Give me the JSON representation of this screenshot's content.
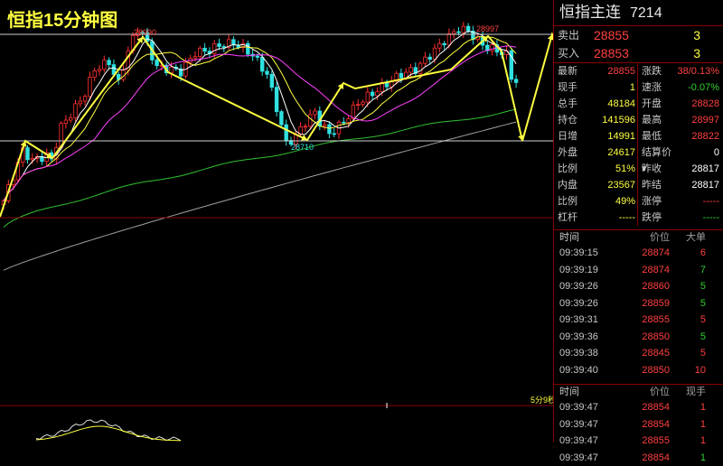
{
  "chart": {
    "title": "恒指15分钟图",
    "peak1_label": "28990",
    "peak2_label": "28997",
    "trough_label": "28710",
    "timer_label": "5分9秒",
    "colors": {
      "up": "#ff3030",
      "down": "#30e0e0",
      "ma1": "#ffffff",
      "ma2": "#ffff40",
      "ma3": "#ff40ff",
      "ma4": "#30c030",
      "ma5": "#a0a0a0",
      "arrow": "#ffff40"
    }
  },
  "chart_data": {
    "type": "candlestick",
    "ylim": [
      28590,
      29045
    ],
    "hlines": [
      28994,
      28725
    ],
    "annotations": [
      {
        "text": "28990",
        "x": 28,
        "y": 28990
      },
      {
        "text": "28997",
        "x": 95,
        "y": 28997
      },
      {
        "text": "28710",
        "x": 59,
        "y": 28710
      }
    ]
  },
  "panel": {
    "name": "恒指主连",
    "code": "7214",
    "sell_label": "卖出",
    "sell_price": "28855",
    "sell_vol": "3",
    "buy_label": "买入",
    "buy_price": "28853",
    "buy_vol": "3",
    "stats": [
      [
        {
          "k": "最新",
          "v": "28855",
          "c": "red"
        },
        {
          "k": "涨跌",
          "v": "38/0.13%",
          "c": "red"
        }
      ],
      [
        {
          "k": "现手",
          "v": "1",
          "c": "yellow"
        },
        {
          "k": "速涨",
          "v": "-0.07%",
          "c": "green"
        }
      ],
      [
        {
          "k": "总手",
          "v": "48184",
          "c": "yellow"
        },
        {
          "k": "开盘",
          "v": "28828",
          "c": "red"
        }
      ],
      [
        {
          "k": "持仓",
          "v": "141596",
          "c": "yellow"
        },
        {
          "k": "最高",
          "v": "28997",
          "c": "red"
        }
      ],
      [
        {
          "k": "日增",
          "v": "14991",
          "c": "yellow"
        },
        {
          "k": "最低",
          "v": "28822",
          "c": "red"
        }
      ],
      [
        {
          "k": "外盘",
          "v": "24617",
          "c": "yellow"
        },
        {
          "k": "结算价▾",
          "v": "0",
          "c": "white"
        }
      ],
      [
        {
          "k": "比例",
          "v": "51%",
          "c": "yellow"
        },
        {
          "k": "昨收",
          "v": "28817",
          "c": "white"
        }
      ],
      [
        {
          "k": "内盘",
          "v": "23567",
          "c": "yellow"
        },
        {
          "k": "昨结",
          "v": "28817",
          "c": "white"
        }
      ],
      [
        {
          "k": "比例",
          "v": "49%",
          "c": "yellow"
        },
        {
          "k": "涨停",
          "v": "-----",
          "c": "red"
        }
      ],
      [
        {
          "k": "杠杆",
          "v": "-----",
          "c": "yellow"
        },
        {
          "k": "跌停",
          "v": "-----",
          "c": "green"
        }
      ]
    ],
    "trades_header": {
      "time": "时间",
      "price": "价位",
      "qty": "大单"
    },
    "trades": [
      {
        "time": "09:39:15",
        "price": "28874",
        "qty": "6",
        "c": "red"
      },
      {
        "time": "09:39:19",
        "price": "28874",
        "qty": "7",
        "c": "green"
      },
      {
        "time": "09:39:26",
        "price": "28860",
        "qty": "5",
        "c": "green"
      },
      {
        "time": "09:39:26",
        "price": "28859",
        "qty": "5",
        "c": "green"
      },
      {
        "time": "09:39:31",
        "price": "28855",
        "qty": "5",
        "c": "red"
      },
      {
        "time": "09:39:36",
        "price": "28850",
        "qty": "5",
        "c": "green"
      },
      {
        "time": "09:39:38",
        "price": "28845",
        "qty": "5",
        "c": "red"
      },
      {
        "time": "09:39:40",
        "price": "28850",
        "qty": "10",
        "c": "red"
      }
    ],
    "ticks_header": {
      "time": "时间",
      "price": "价位",
      "qty": "现手"
    },
    "ticks": [
      {
        "time": "09:39:47",
        "price": "28854",
        "qty": "1",
        "c": "red"
      },
      {
        "time": "09:39:47",
        "price": "28854",
        "qty": "1",
        "c": "red"
      },
      {
        "time": "09:39:47",
        "price": "28855",
        "qty": "1",
        "c": "red"
      },
      {
        "time": "09:39:47",
        "price": "28854",
        "qty": "1",
        "c": "green"
      }
    ]
  }
}
